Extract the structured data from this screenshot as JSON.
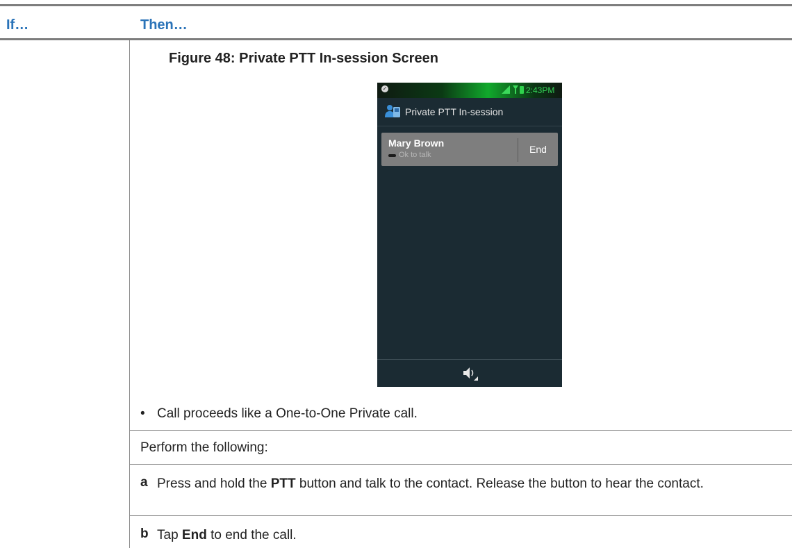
{
  "table": {
    "col_if": "If…",
    "col_then": "Then…"
  },
  "figure": {
    "caption": "Figure 48: Private PTT In-session Screen"
  },
  "phone": {
    "status_time": "2:43PM",
    "app_title": "Private PTT In-session",
    "contact": {
      "name": "Mary Brown",
      "status": "Ok to talk",
      "end_label": "End"
    },
    "colors": {
      "background": "#1b2b33",
      "status_green": "#35d256",
      "card": "#7e7e7e"
    },
    "icons": [
      "check-icon",
      "signal-icon",
      "wifi-icon",
      "battery-icon",
      "contacts-icon",
      "speaker-icon"
    ]
  },
  "content": {
    "bullet": "Call proceeds like a One-to-One Private call.",
    "perform": "Perform the following:",
    "steps": [
      {
        "letter": "a",
        "pre": "Press and hold the ",
        "bold": "PTT",
        "post": " button and talk to the contact. Release the button to hear the contact."
      },
      {
        "letter": "b",
        "pre": "Tap ",
        "bold": "End",
        "post": " to end the call."
      }
    ]
  }
}
